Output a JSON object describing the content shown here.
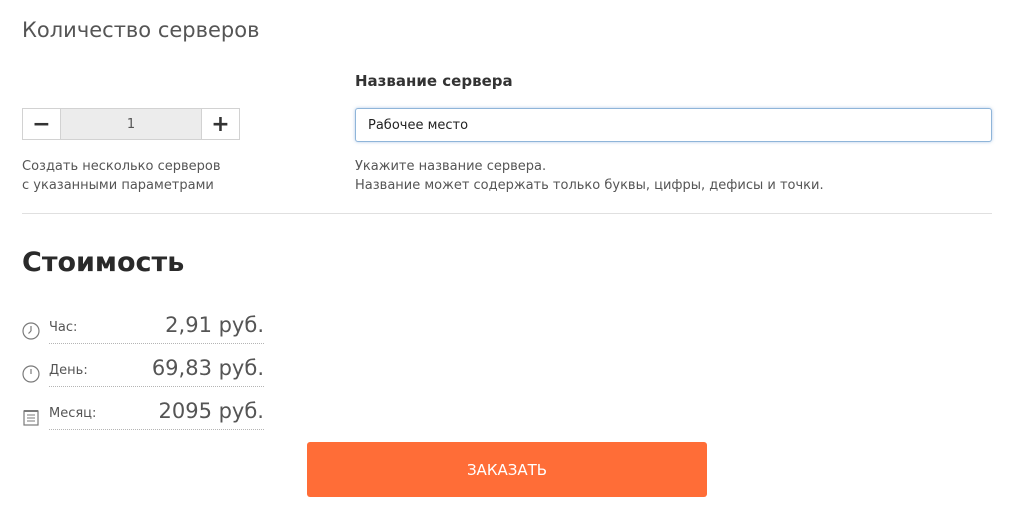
{
  "servers": {
    "title": "Количество серверов",
    "stepper": {
      "minus_label": "−",
      "value": "1",
      "plus_label": "+"
    },
    "hint_line1": "Создать несколько серверов",
    "hint_line2": "с указанными параметрами"
  },
  "server_name": {
    "label": "Название сервера",
    "value": "Рабочее место",
    "hint_line1": "Укажите название сервера.",
    "hint_line2": "Название может содержать только буквы, цифры, дефисы и точки."
  },
  "cost": {
    "title": "Стоимость",
    "rows": [
      {
        "icon": "clock-icon",
        "label": "Час:",
        "amount": "2,91 руб."
      },
      {
        "icon": "clock-icon",
        "label": "День:",
        "amount": "69,83 руб."
      },
      {
        "icon": "calendar-icon",
        "label": "Месяц:",
        "amount": "2095 руб."
      }
    ]
  },
  "order_button": {
    "label": "ЗАКАЗАТЬ",
    "color": "#ff6d37"
  }
}
